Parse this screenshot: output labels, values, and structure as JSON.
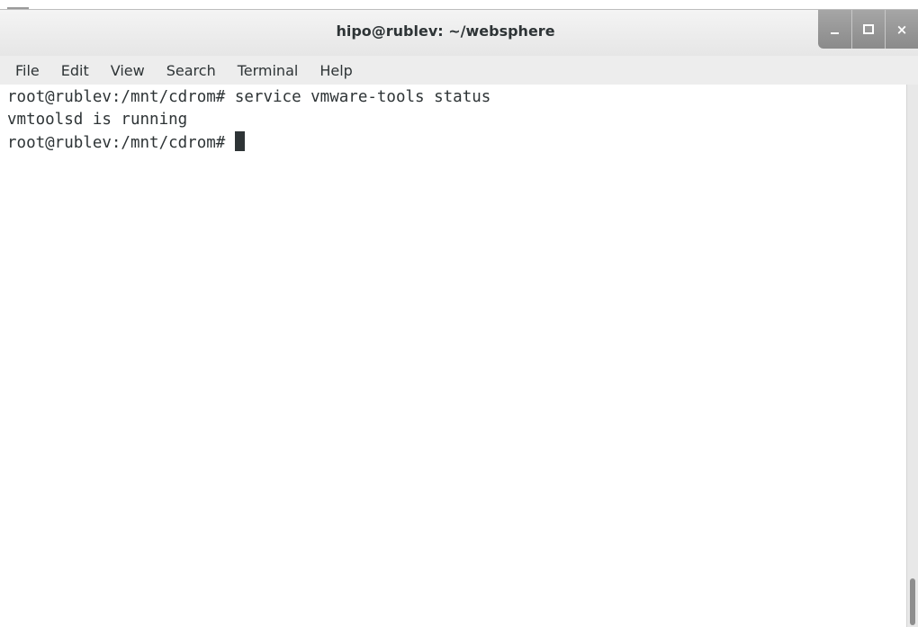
{
  "window": {
    "title": "hipo@rublev: ~/websphere",
    "minimize_label": "_",
    "maximize_icon": "maximize-icon",
    "close_label": "×"
  },
  "menu": {
    "items": [
      "File",
      "Edit",
      "View",
      "Search",
      "Terminal",
      "Help"
    ]
  },
  "terminal": {
    "lines": [
      "root@rublev:/mnt/cdrom# service vmware-tools status",
      "vmtoolsd is running",
      "root@rublev:/mnt/cdrom# "
    ],
    "text_color": "#2e3436",
    "background": "#ffffff"
  },
  "scrollbar": {
    "position": "bottom"
  }
}
